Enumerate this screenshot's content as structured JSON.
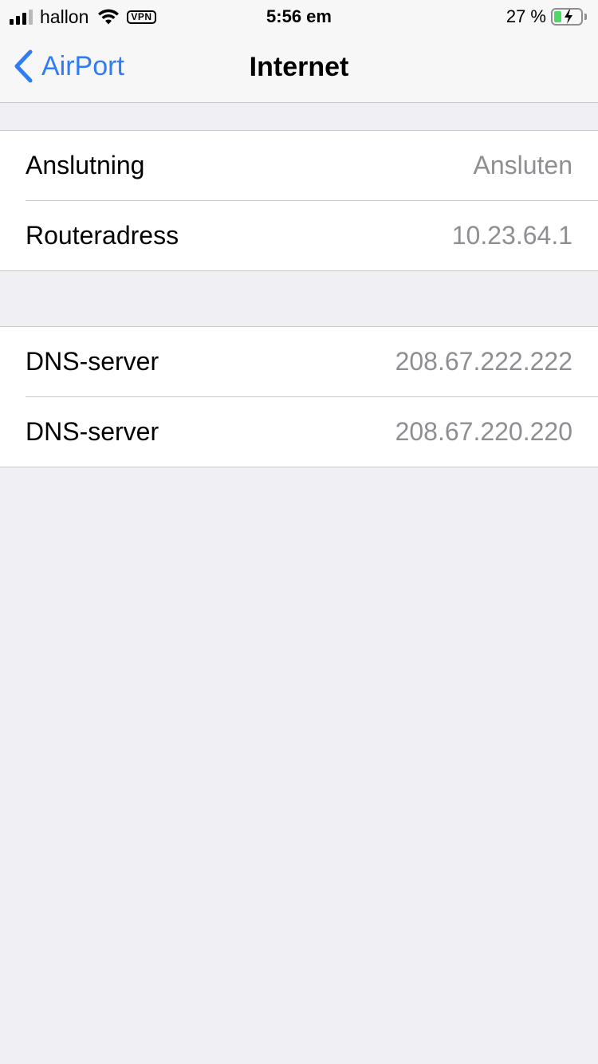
{
  "status_bar": {
    "carrier": "hallon",
    "vpn": "VPN",
    "time": "5:56 em",
    "battery_percent": "27 %",
    "battery_level": 0.27,
    "signal_bars": 3,
    "signal_max": 4
  },
  "nav": {
    "back_label": "AirPort",
    "title": "Internet",
    "accent_color": "#2f7cf6"
  },
  "sections": [
    {
      "rows": [
        {
          "label": "Anslutning",
          "value": "Ansluten"
        },
        {
          "label": "Routeradress",
          "value": "10.23.64.1"
        }
      ]
    },
    {
      "rows": [
        {
          "label": "DNS-server",
          "value": "208.67.222.222"
        },
        {
          "label": "DNS-server",
          "value": "208.67.220.220"
        }
      ]
    }
  ],
  "icons": [
    "cellular-signal-icon",
    "wifi-icon",
    "vpn-icon",
    "battery-charging-icon",
    "chevron-left-icon"
  ]
}
